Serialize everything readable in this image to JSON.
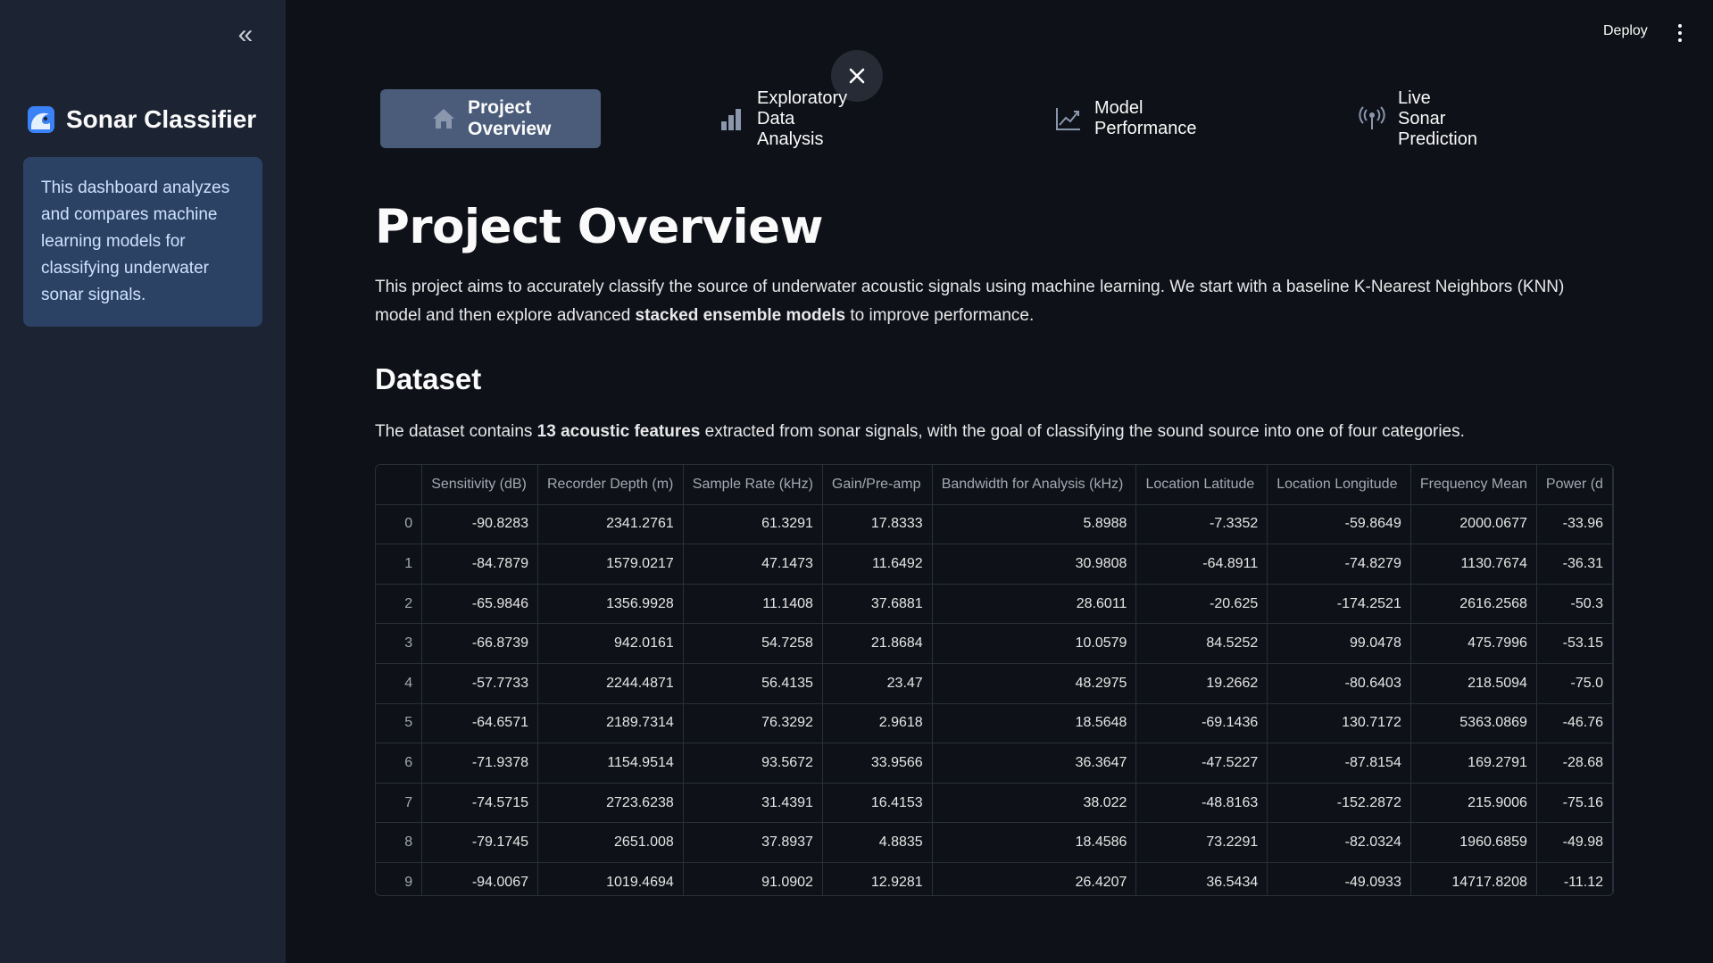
{
  "sidebar": {
    "title": "Sonar Classifier",
    "collapse_icon": "«",
    "info": "This dashboard analyzes and compares machine learning models for classifying underwater sonar signals."
  },
  "topbar": {
    "deploy": "Deploy"
  },
  "tabs": [
    {
      "label": "Project Overview",
      "icon": "home-icon",
      "active": true
    },
    {
      "label": "Exploratory Data Analysis",
      "icon": "bar-chart-icon",
      "active": false
    },
    {
      "label": "Model Performance",
      "icon": "line-chart-icon",
      "active": false
    },
    {
      "label": "Live Sonar Prediction",
      "icon": "antenna-icon",
      "active": false
    }
  ],
  "main": {
    "title": "Project Overview",
    "intro_part1": "This project aims to accurately classify the source of underwater acoustic signals using machine learning. We start with a baseline K-Nearest Neighbors (KNN) model and then explore advanced ",
    "intro_bold": "stacked ensemble models",
    "intro_part2": " to improve performance.",
    "dataset_heading": "Dataset",
    "dataset_part1": "The dataset contains ",
    "dataset_bold": "13 acoustic features",
    "dataset_part2": " extracted from sonar signals, with the goal of classifying the sound source into one of four categories."
  },
  "table": {
    "columns": [
      "",
      "Sensitivity (dB)",
      "Recorder Depth (m)",
      "Sample Rate (kHz)",
      "Gain/Pre-amp",
      "Bandwidth for Analysis (kHz)",
      "Location Latitude",
      "Location Longitude",
      "Frequency Mean",
      "Power (d"
    ],
    "rows": [
      [
        "0",
        "-90.8283",
        "2341.2761",
        "61.3291",
        "17.8333",
        "5.8988",
        "-7.3352",
        "-59.8649",
        "2000.0677",
        "-33.96"
      ],
      [
        "1",
        "-84.7879",
        "1579.0217",
        "47.1473",
        "11.6492",
        "30.9808",
        "-64.8911",
        "-74.8279",
        "1130.7674",
        "-36.31"
      ],
      [
        "2",
        "-65.9846",
        "1356.9928",
        "11.1408",
        "37.6881",
        "28.6011",
        "-20.625",
        "-174.2521",
        "2616.2568",
        "-50.3"
      ],
      [
        "3",
        "-66.8739",
        "942.0161",
        "54.7258",
        "21.8684",
        "10.0579",
        "84.5252",
        "99.0478",
        "475.7996",
        "-53.15"
      ],
      [
        "4",
        "-57.7733",
        "2244.4871",
        "56.4135",
        "23.47",
        "48.2975",
        "19.2662",
        "-80.6403",
        "218.5094",
        "-75.0"
      ],
      [
        "5",
        "-64.6571",
        "2189.7314",
        "76.3292",
        "2.9618",
        "18.5648",
        "-69.1436",
        "130.7172",
        "5363.0869",
        "-46.76"
      ],
      [
        "6",
        "-71.9378",
        "1154.9514",
        "93.5672",
        "33.9566",
        "36.3647",
        "-47.5227",
        "-87.8154",
        "169.2791",
        "-28.68"
      ],
      [
        "7",
        "-74.5715",
        "2723.6238",
        "31.4391",
        "16.4153",
        "38.022",
        "-48.8163",
        "-152.2872",
        "215.9006",
        "-75.16"
      ],
      [
        "8",
        "-79.1745",
        "2651.008",
        "37.8937",
        "4.8835",
        "18.4586",
        "73.2291",
        "-82.0324",
        "1960.6859",
        "-49.98"
      ],
      [
        "9",
        "-94.0067",
        "1019.4694",
        "91.0902",
        "12.9281",
        "26.4207",
        "36.5434",
        "-49.0933",
        "14717.8208",
        "-11.12"
      ]
    ]
  },
  "colors": {
    "background": "#0e1117",
    "sidebar": "#1c2333",
    "info_box": "#2b4264",
    "active_tab": "#4a5c7a"
  }
}
